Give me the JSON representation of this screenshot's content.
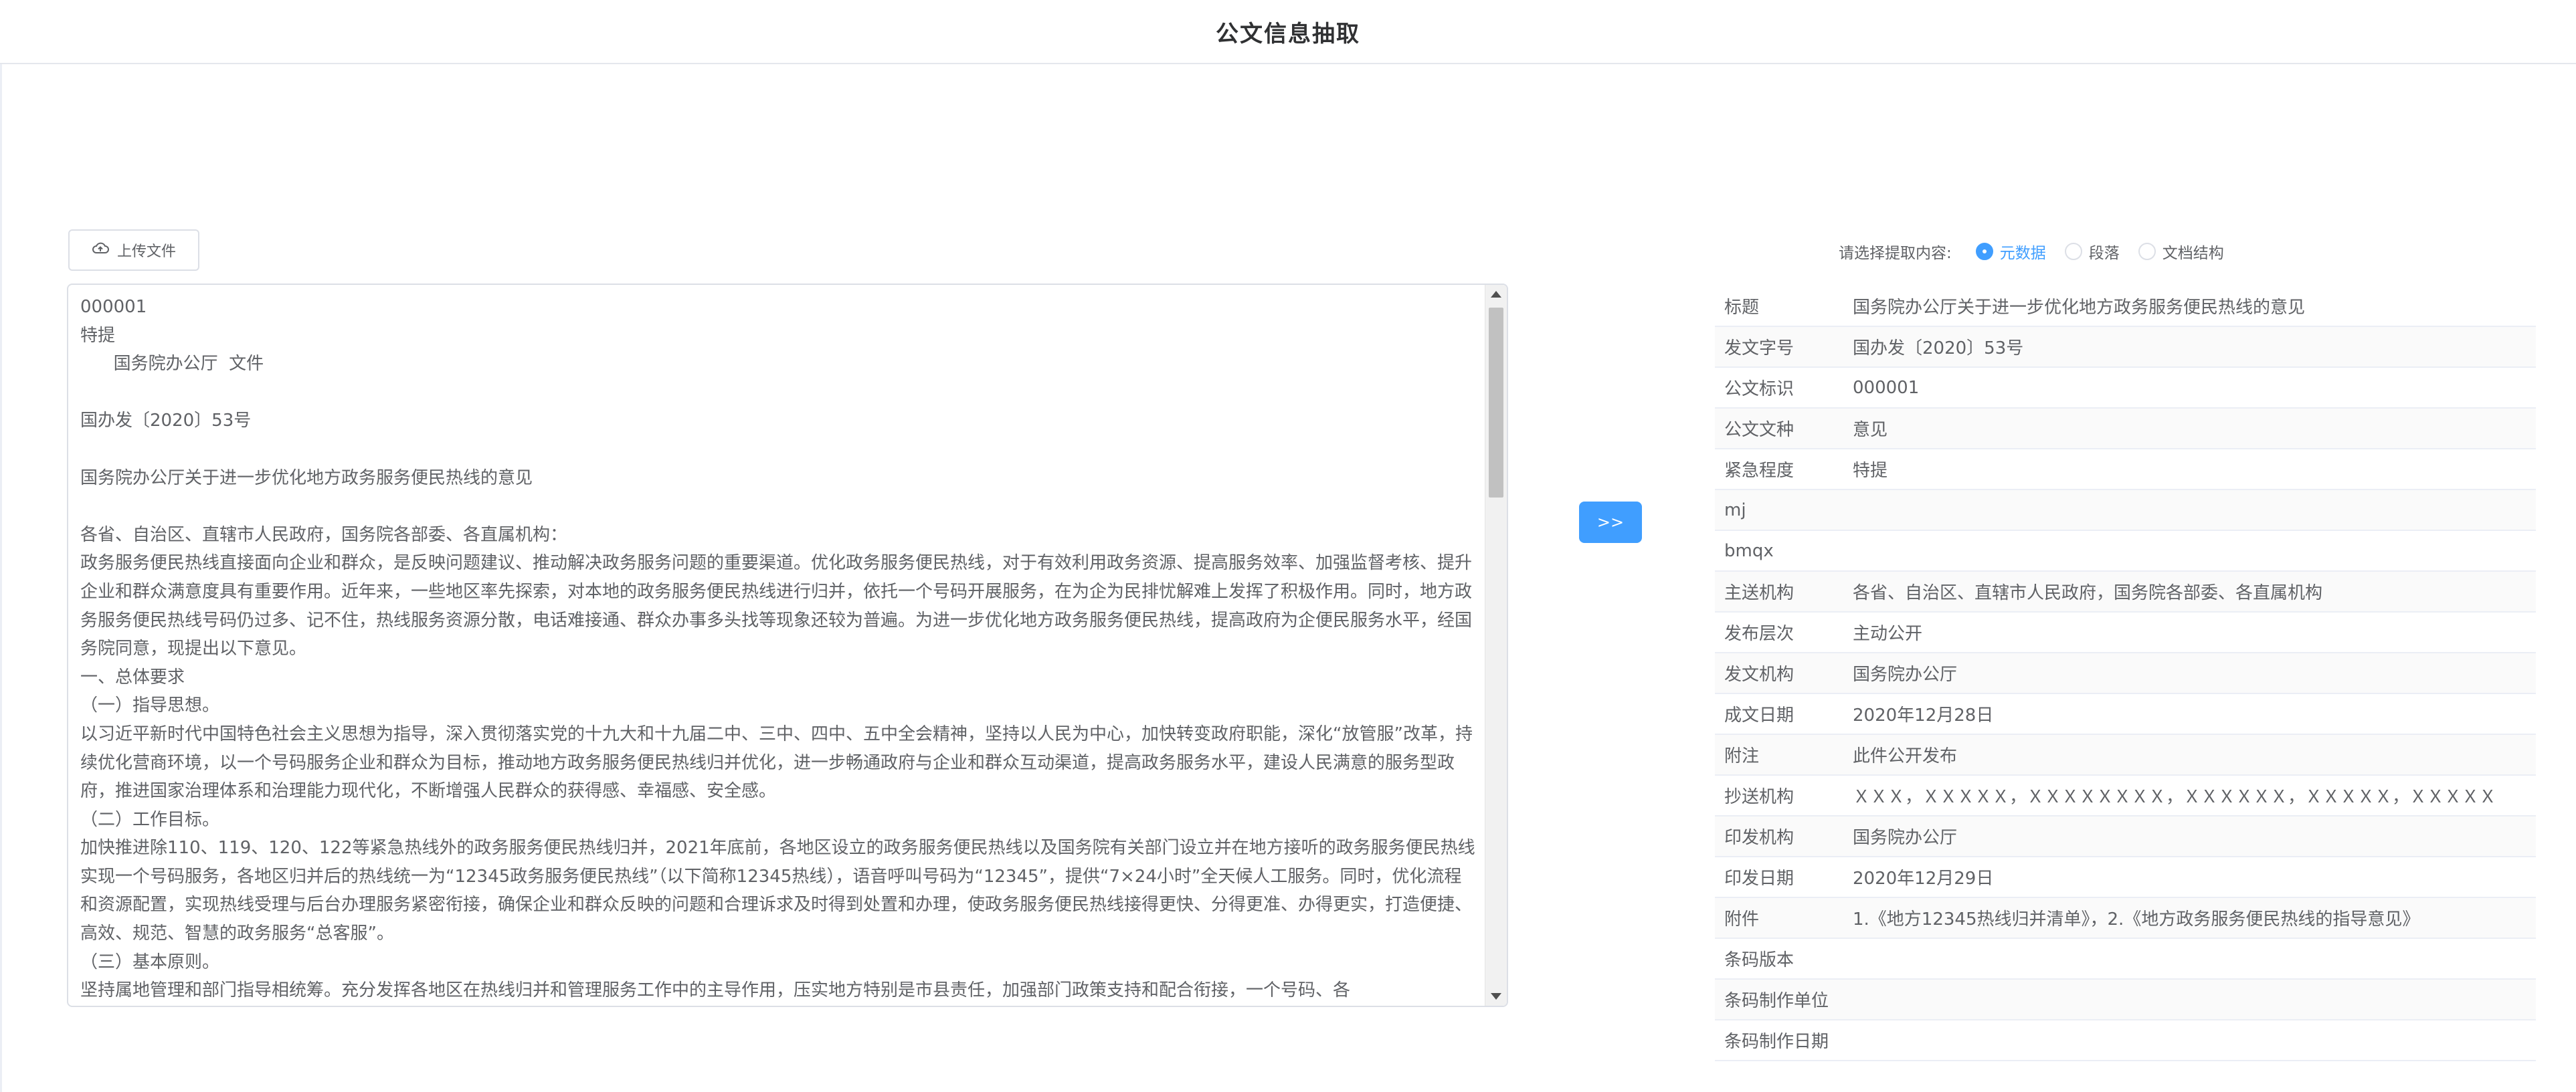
{
  "header": {
    "title": "公文信息抽取"
  },
  "upload": {
    "label": "上传文件"
  },
  "document": {
    "text": "000001\n特提\n      国务院办公厅  文件\n\n国办发〔2020〕53号\n\n国务院办公厅关于进一步优化地方政务服务便民热线的意见\n\n各省、自治区、直辖市人民政府，国务院各部委、各直属机构：\n政务服务便民热线直接面向企业和群众，是反映问题建议、推动解决政务服务问题的重要渠道。优化政务服务便民热线，对于有效利用政务资源、提高服务效率、加强监督考核、提升企业和群众满意度具有重要作用。近年来，一些地区率先探索，对本地的政务服务便民热线进行归并，依托一个号码开展服务，在为企为民排忧解难上发挥了积极作用。同时，地方政务服务便民热线号码仍过多、记不住，热线服务资源分散，电话难接通、群众办事多头找等现象还较为普遍。为进一步优化地方政务服务便民热线，提高政府为企便民服务水平，经国务院同意，现提出以下意见。\n一、总体要求\n（一）指导思想。\n以习近平新时代中国特色社会主义思想为指导，深入贯彻落实党的十九大和十九届二中、三中、四中、五中全会精神，坚持以人民为中心，加快转变政府职能，深化“放管服”改革，持续优化营商环境，以一个号码服务企业和群众为目标，推动地方政务服务便民热线归并优化，进一步畅通政府与企业和群众互动渠道，提高政务服务水平，建设人民满意的服务型政府，推进国家治理体系和治理能力现代化，不断增强人民群众的获得感、幸福感、安全感。\n（二）工作目标。\n加快推进除110、119、120、122等紧急热线外的政务服务便民热线归并，2021年底前，各地区设立的政务服务便民热线以及国务院有关部门设立并在地方接听的政务服务便民热线实现一个号码服务，各地区归并后的热线统一为“12345政务服务便民热线”（以下简称12345热线），语音呼叫号码为“12345”，提供“7×24小时”全天候人工服务。同时，优化流程和资源配置，实现热线受理与后台办理服务紧密衔接，确保企业和群众反映的问题和合理诉求及时得到处置和办理，使政务服务便民热线接得更快、分得更准、办得更实，打造便捷、高效、规范、智慧的政务服务“总客服”。\n（三）基本原则。\n坚持属地管理和部门指导相统筹。充分发挥各地区在热线归并和管理服务工作中的主导作用，压实地方特别是市县责任，加强部门政策支持和配合衔接，一个号码、各"
  },
  "action": {
    "label": ">>"
  },
  "extract": {
    "prompt": "请选择提取内容:",
    "options": [
      {
        "label": "元数据",
        "checked": true
      },
      {
        "label": "段落",
        "checked": false
      },
      {
        "label": "文档结构",
        "checked": false
      }
    ]
  },
  "metadata": [
    {
      "key": "标题",
      "value": "国务院办公厅关于进一步优化地方政务服务便民热线的意见"
    },
    {
      "key": "发文字号",
      "value": "国办发〔2020〕53号"
    },
    {
      "key": "公文标识",
      "value": "000001"
    },
    {
      "key": "公文文种",
      "value": "意见"
    },
    {
      "key": "紧急程度",
      "value": "特提"
    },
    {
      "key": "mj",
      "value": ""
    },
    {
      "key": "bmqx",
      "value": ""
    },
    {
      "key": "主送机构",
      "value": "各省、自治区、直辖市人民政府，国务院各部委、各直属机构"
    },
    {
      "key": "发布层次",
      "value": "主动公开"
    },
    {
      "key": "发文机构",
      "value": "国务院办公厅"
    },
    {
      "key": "成文日期",
      "value": "2020年12月28日"
    },
    {
      "key": "附注",
      "value": "此件公开发布"
    },
    {
      "key": "抄送机构",
      "value": "ＸＸＸ，ＸＸＸＸＸ，ＸＸＸＸＸＸＸＸ，ＸＸＸＸＸＸ，ＸＸＸＸＸ，ＸＸＸＸＸ"
    },
    {
      "key": "印发机构",
      "value": "国务院办公厅"
    },
    {
      "key": "印发日期",
      "value": "2020年12月29日"
    },
    {
      "key": "附件",
      "value": "1.《地方12345热线归并清单》，2.《地方政务服务便民热线的指导意见》"
    },
    {
      "key": "条码版本",
      "value": ""
    },
    {
      "key": "条码制作单位",
      "value": ""
    },
    {
      "key": "条码制作日期",
      "value": ""
    }
  ]
}
